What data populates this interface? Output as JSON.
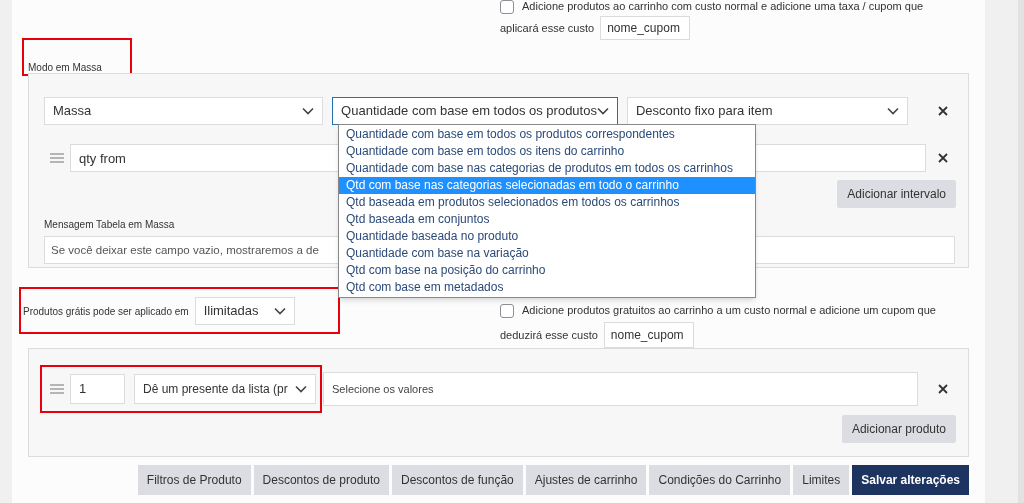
{
  "top_option": {
    "checked": false,
    "label": "Adicione produtos ao carrinho com custo normal e adicione uma taxa / cupom que",
    "cost_label": "aplicará esse custo",
    "coupon_value": "nome_cupom"
  },
  "bulk_mode": {
    "title": "Modo em Massa",
    "highlighted": true,
    "type_select": {
      "value": "Massa"
    },
    "count_select": {
      "value": "Quantidade com base em todos os produtos",
      "open": true,
      "options": [
        {
          "label": "Quantidade com base em todos os produtos correspondentes",
          "selected": false
        },
        {
          "label": "Quantidade com base em todos os itens do carrinho",
          "selected": false
        },
        {
          "label": "Quantidade com base nas categorias de produtos em todos os carrinhos",
          "selected": false
        },
        {
          "label": "Qtd com base nas categorias selecionadas em todo o carrinho",
          "selected": true
        },
        {
          "label": "Qtd baseada em produtos selecionados em todos os carrinhos",
          "selected": false
        },
        {
          "label": "Qtd baseada em conjuntos",
          "selected": false
        },
        {
          "label": "Quantidade baseada no produto",
          "selected": false
        },
        {
          "label": "Quantidade com base na variação",
          "selected": false
        },
        {
          "label": "Qtd com base na posição do carrinho",
          "selected": false
        },
        {
          "label": "Qtd com base em metadados",
          "selected": false
        }
      ]
    },
    "discount_select": {
      "value": "Desconto fixo para item"
    },
    "range": {
      "placeholder": "qty from"
    },
    "add_range_button": "Adicionar intervalo",
    "message_label": "Mensagem Tabela em Massa",
    "message_field": {
      "placeholder": "Se você deixar este campo vazio, mostraremos a de"
    }
  },
  "free_products": {
    "label": "Produtos grátis pode ser aplicado em",
    "value": "Ilimitadas",
    "highlighted": true
  },
  "free_option": {
    "checked": false,
    "label": "Adicione produtos gratuitos ao carrinho a um custo normal e adicione um cupom que",
    "cost_label": "deduzirá esse custo",
    "coupon_value": "nome_cupom"
  },
  "gift_rule": {
    "highlighted": true,
    "quantity": "1",
    "mode": "Dê um presente da lista (pr",
    "values_placeholder": "Selecione os valores",
    "add_button": "Adicionar produto"
  },
  "footer_buttons": [
    {
      "label": "Filtros de Produto",
      "kind": "secondary"
    },
    {
      "label": "Descontos de produto",
      "kind": "secondary"
    },
    {
      "label": "Descontos de função",
      "kind": "secondary"
    },
    {
      "label": "Ajustes de carrinho",
      "kind": "secondary"
    },
    {
      "label": "Condições do Carrinho",
      "kind": "secondary"
    },
    {
      "label": "Limites",
      "kind": "secondary"
    },
    {
      "label": "Salvar alterações",
      "kind": "primary"
    }
  ]
}
